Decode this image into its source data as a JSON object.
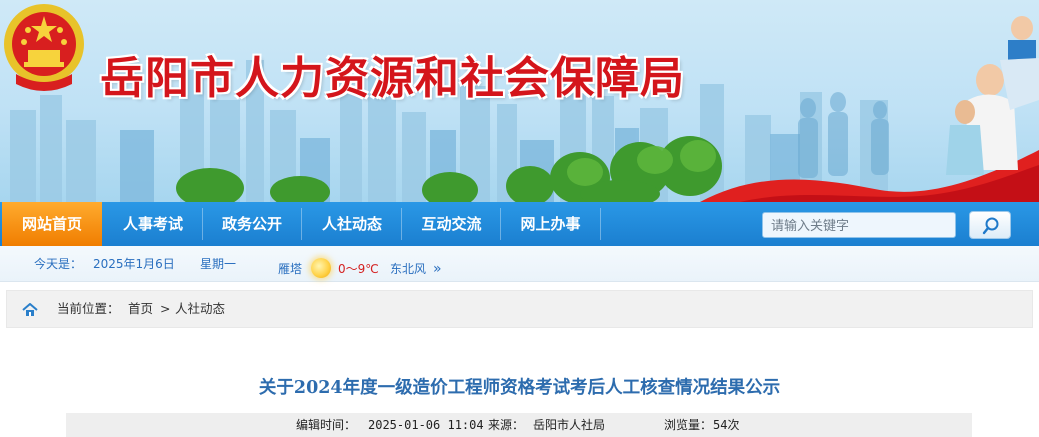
{
  "site": {
    "title": "岳阳市人力资源和社会保障局"
  },
  "nav": {
    "items": [
      {
        "label": "网站首页",
        "active": true
      },
      {
        "label": "人事考试",
        "active": false
      },
      {
        "label": "政务公开",
        "active": false
      },
      {
        "label": "人社动态",
        "active": false
      },
      {
        "label": "互动交流",
        "active": false
      },
      {
        "label": "网上办事",
        "active": false
      }
    ],
    "search_placeholder": "请输入关键字",
    "search_icon": "search-icon"
  },
  "info": {
    "today_label": "今天是：",
    "date": "2025年1月6日",
    "weekday": "星期一",
    "city": "雁塔",
    "weather_icon": "sunny-icon",
    "temperature": "0～9℃",
    "wind": "东北风",
    "more": "»"
  },
  "breadcrumb": {
    "home_icon": "home-icon",
    "label": "当前位置：",
    "home": "首页",
    "separator": ">",
    "current": "人社动态"
  },
  "article": {
    "title": "关于2024年度一级造价工程师资格考试考后人工核查情况结果公示",
    "edit_time_label": "编辑时间：",
    "edit_time": "2025-01-06 11:04",
    "source_label": "来源：",
    "source": "岳阳市人社局",
    "views_label": "浏览量：",
    "views": "54次"
  },
  "colors": {
    "nav_blue": "#1b7fd0",
    "nav_active": "#f07d00",
    "title_red": "#d4151b",
    "article_title": "#2d6cae",
    "info_blue": "#2a6fbf",
    "temperature_red": "#d42020"
  }
}
